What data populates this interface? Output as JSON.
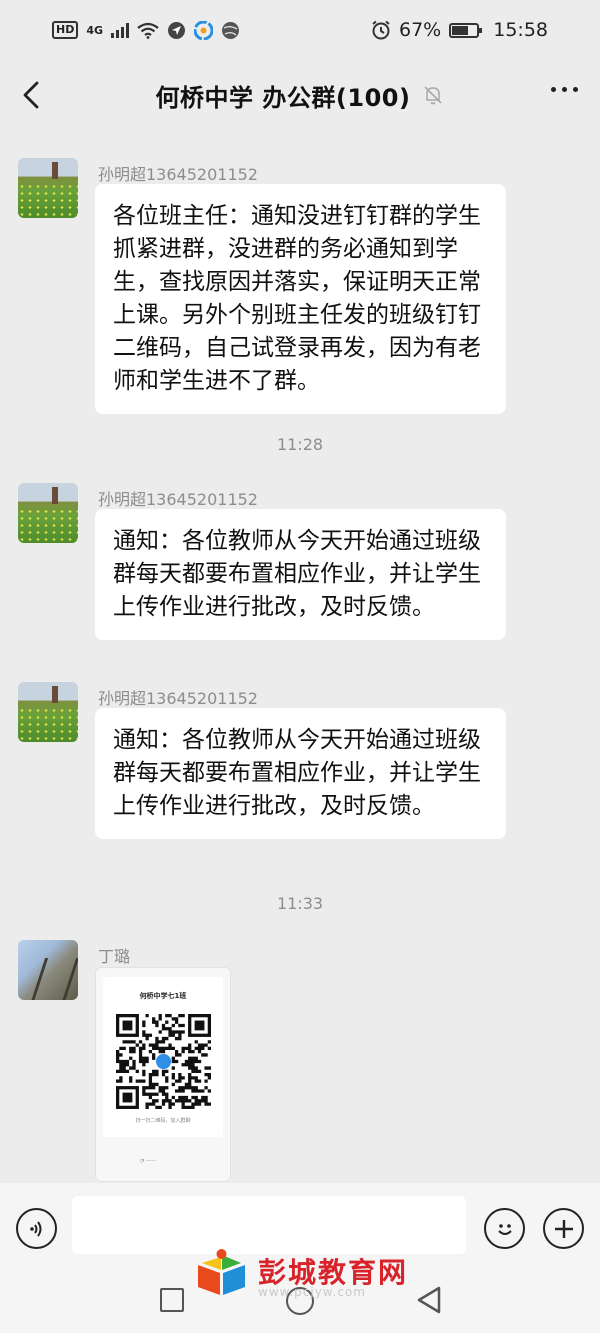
{
  "status_bar": {
    "hd": "HD",
    "network": "4G",
    "battery_percent": "67%",
    "battery_level": 0.67,
    "time": "15:58"
  },
  "header": {
    "title": "何桥中学  办公群(100)"
  },
  "messages": [
    {
      "sender": "孙明超13645201152",
      "text": "各位班主任：通知没进钉钉群的学生抓紧进群，没进群的务必通知到学生，查找原因并落实，保证明天正常上课。另外个别班主任发的班级钉钉二维码，自己试登录再发，因为有老师和学生进不了群。"
    },
    {
      "sender": "孙明超13645201152",
      "text": "通知：各位教师从今天开始通过班级群每天都要布置相应作业，并让学生上传作业进行批改，及时反馈。"
    },
    {
      "sender": "孙明超13645201152",
      "text": "通知：各位教师从今天开始通过班级群每天都要布置相应作业，并让学生上传作业进行批改，及时反馈。"
    },
    {
      "sender": "丁璐",
      "qr_title": "何桥中学七1班",
      "qr_caption": "扫一扫二维码，加入群聊"
    }
  ],
  "timestamps": [
    "11:28",
    "11:33"
  ],
  "input": {
    "placeholder": ""
  },
  "watermark": {
    "text": "彭城教育网",
    "url": "www.pcjyw.com"
  },
  "colors": {
    "background": "#ececec",
    "bubble": "#ffffff",
    "meta_text": "#8d8d8d",
    "watermark_red": "#d8232a"
  }
}
